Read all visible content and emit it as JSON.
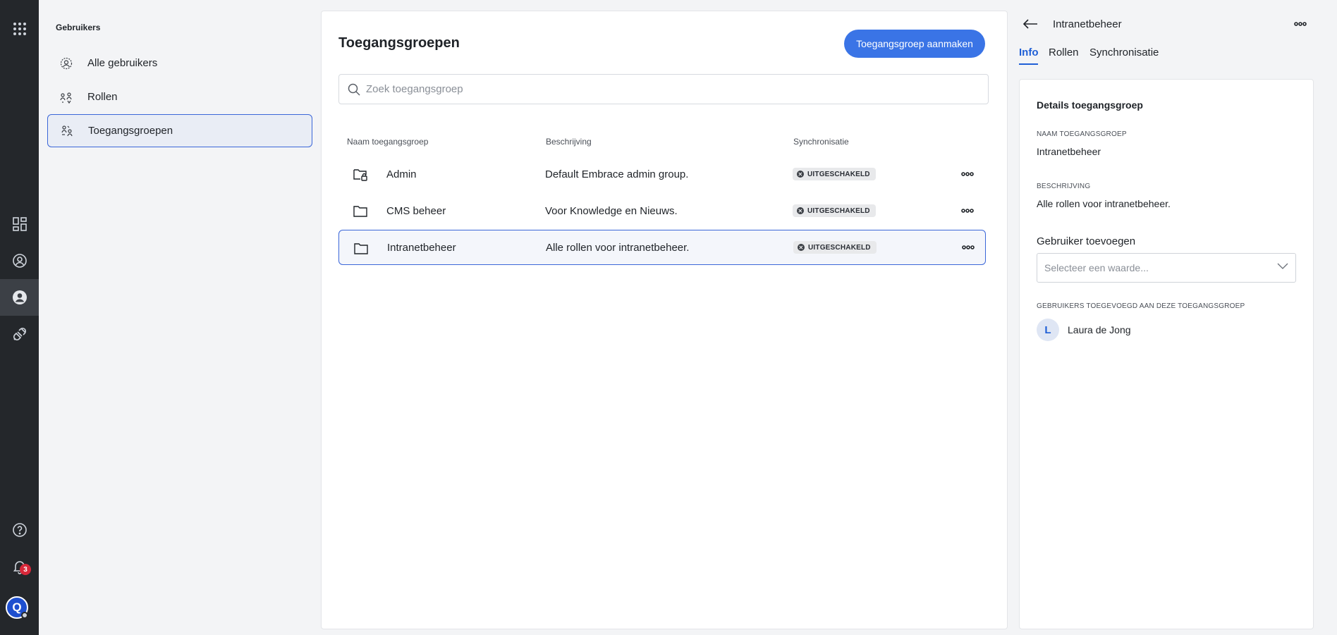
{
  "rail": {
    "notification_count": "3",
    "profile_initial": "Q"
  },
  "sidebar": {
    "title": "Gebruikers",
    "items": [
      {
        "label": "Alle gebruikers",
        "icon": "users-icon"
      },
      {
        "label": "Rollen",
        "icon": "roles-icon"
      },
      {
        "label": "Toegangsgroepen",
        "icon": "access-groups-icon",
        "active": true
      }
    ]
  },
  "main": {
    "title": "Toegangsgroepen",
    "create_button": "Toegangsgroep aanmaken",
    "search_placeholder": "Zoek toegangsgroep",
    "columns": [
      "Naam toegangsgroep",
      "Beschrijving",
      "Synchronisatie"
    ],
    "rows": [
      {
        "name": "Admin",
        "description": "Default Embrace admin group.",
        "sync": "UITGESCHAKELD",
        "icon": "locked-folder-icon"
      },
      {
        "name": "CMS beheer",
        "description": "Voor Knowledge en Nieuws.",
        "sync": "UITGESCHAKELD",
        "icon": "folder-icon"
      },
      {
        "name": "Intranetbeheer",
        "description": "Alle rollen voor intranetbeheer.",
        "sync": "UITGESCHAKELD",
        "icon": "folder-icon",
        "selected": true
      }
    ]
  },
  "detail": {
    "title": "Intranetbeheer",
    "tabs": [
      "Info",
      "Rollen",
      "Synchronisatie"
    ],
    "active_tab": "Info",
    "card_title": "Details toegangsgroep",
    "name_caption": "NAAM TOEGANGSGROEP",
    "name_value": "Intranetbeheer",
    "desc_caption": "BESCHRIJVING",
    "desc_value": "Alle rollen voor intranetbeheer.",
    "add_user_label": "Gebruiker toevoegen",
    "add_user_placeholder": "Selecteer een waarde...",
    "members_caption": "GEBRUIKERS TOEGEVOEGD AAN DEZE TOEGANGSGROEP",
    "members": [
      {
        "initial": "L",
        "name": "Laura de Jong"
      }
    ]
  },
  "colors": {
    "accent": "#3a74e6",
    "rail": "#24272b",
    "badge": "#d8283a"
  }
}
